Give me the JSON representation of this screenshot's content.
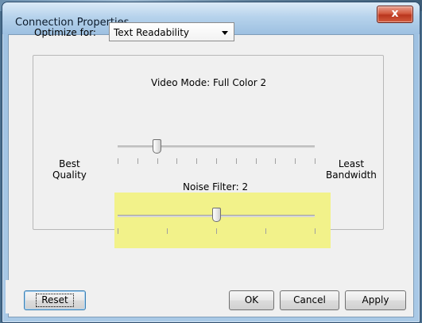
{
  "window": {
    "title": "Connection Properties",
    "close_symbol": "x"
  },
  "optimize": {
    "label": "Optimize for:",
    "selected": "Text Readability"
  },
  "video_mode": {
    "label": "Video Mode: Full Color 2",
    "level": 0.2
  },
  "noise_filter": {
    "label": "Noise Filter: 2",
    "level": 0.5
  },
  "scale": {
    "left_line1": "Best",
    "left_line2": "Quality",
    "right_line1": "Least",
    "right_line2": "Bandwidth"
  },
  "buttons": {
    "reset": "Reset",
    "ok": "OK",
    "cancel": "Cancel",
    "apply": "Apply"
  },
  "colors": {
    "highlight": "#f2f28a",
    "title_bar": "#b7d3ec"
  },
  "icons": {
    "dropdown": "chevron-down-icon",
    "close": "close-icon"
  }
}
